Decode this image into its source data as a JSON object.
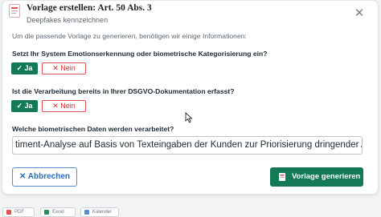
{
  "dialog": {
    "title": "Vorlage erstellen: Art. 50 Abs. 3",
    "subtitle": "Deepfakes kennzeichnen",
    "intro": "Um die passende Vorlage zu generieren, benötigen wir einige Informationen:"
  },
  "questions": [
    {
      "label": "Setzt Ihr System Emotionserkennung oder biometrische Kategorisierung ein?",
      "yes": "✓ Ja",
      "no": "✕ Nein",
      "selected": "yes"
    },
    {
      "label": "Ist die Verarbeitung bereits in Ihrer DSGVO-Dokumentation erfasst?",
      "yes": "✓ Ja",
      "no": "✕ Nein",
      "selected": "yes"
    }
  ],
  "biometric": {
    "label": "Welche biometrischen Daten werden verarbeitet?",
    "value": "timent-Analyse auf Basis von Texteingaben der Kunden zur Priorisierung dringender Anfragen"
  },
  "actions": {
    "cancel": "✕ Abbrechen",
    "generate": "Vorlage generieren"
  },
  "exports": [
    "PDF",
    "Excel",
    "Kalender"
  ],
  "colors": {
    "primary": "#137a55",
    "danger": "#d9534f",
    "cancel": "#2b6cb8"
  },
  "icons": {
    "header": "document-icon",
    "close": "close-icon",
    "generate": "file-icon"
  }
}
